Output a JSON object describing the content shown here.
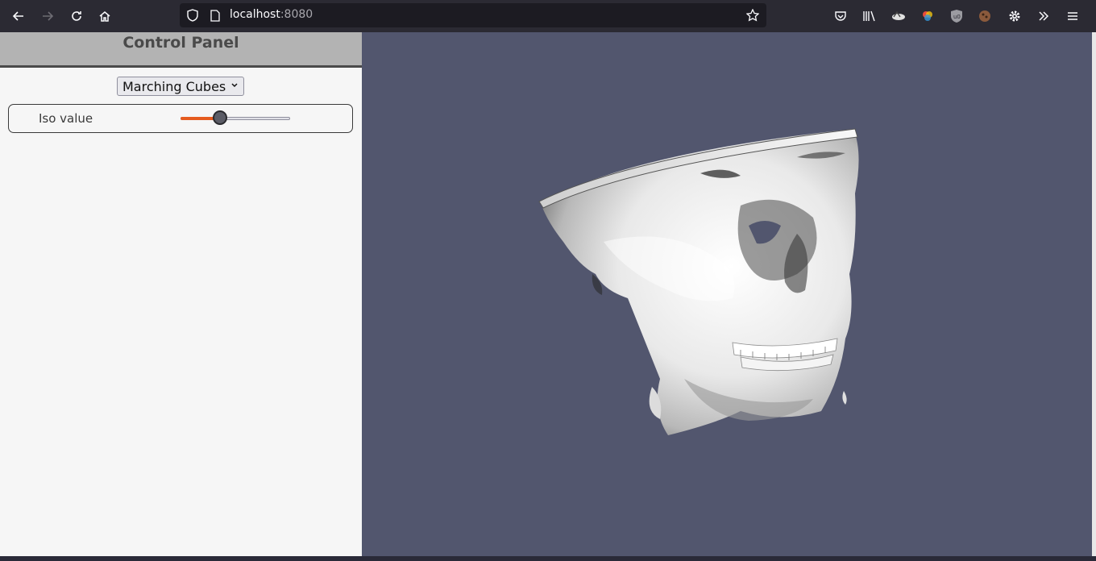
{
  "browser": {
    "url_host": "localhost",
    "url_port": ":8080",
    "icons": [
      "back-icon",
      "forward-icon",
      "reload-icon",
      "home-icon",
      "shield-icon",
      "page-icon",
      "star-icon",
      "pocket-icon",
      "library-icon",
      "extension-icon",
      "extension-icon",
      "ublock-icon",
      "extension-icon",
      "settings-icon",
      "overflow-icon",
      "menu-icon"
    ]
  },
  "panel": {
    "title": "Control Panel",
    "algorithm_select": {
      "value": "Marching Cubes"
    },
    "iso": {
      "label": "Iso value",
      "fraction": 0.36
    }
  },
  "colors": {
    "viewport_bg": "#52566e",
    "slider_accent": "#e55b1f"
  }
}
